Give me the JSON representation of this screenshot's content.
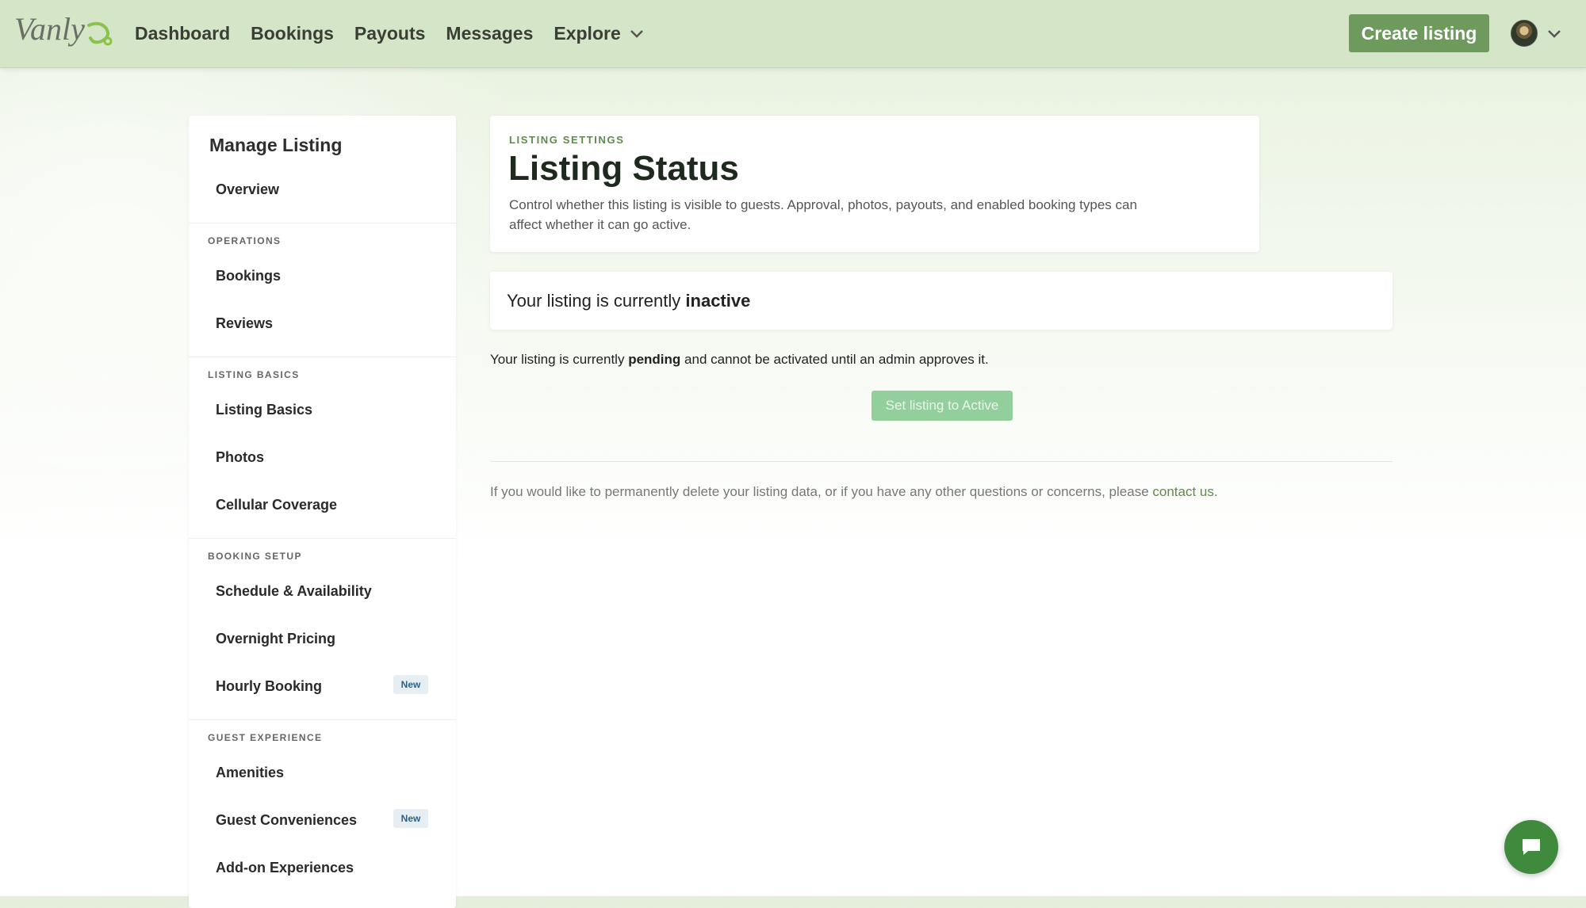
{
  "brand": {
    "logo_text": "Vanly"
  },
  "nav": {
    "items": [
      {
        "label": "Dashboard"
      },
      {
        "label": "Bookings"
      },
      {
        "label": "Payouts"
      },
      {
        "label": "Messages"
      },
      {
        "label": "Explore"
      }
    ],
    "create_label": "Create listing"
  },
  "sidebar": {
    "title": "Manage Listing",
    "overview": "Overview",
    "sections": [
      {
        "label": "OPERATIONS",
        "items": [
          {
            "label": "Bookings"
          },
          {
            "label": "Reviews"
          }
        ]
      },
      {
        "label": "LISTING BASICS",
        "items": [
          {
            "label": "Listing Basics"
          },
          {
            "label": "Photos"
          },
          {
            "label": "Cellular Coverage"
          }
        ]
      },
      {
        "label": "BOOKING SETUP",
        "items": [
          {
            "label": "Schedule & Availability"
          },
          {
            "label": "Overnight Pricing"
          },
          {
            "label": "Hourly Booking",
            "badge": "New"
          }
        ]
      },
      {
        "label": "GUEST EXPERIENCE",
        "items": [
          {
            "label": "Amenities"
          },
          {
            "label": "Guest Conveniences",
            "badge": "New"
          },
          {
            "label": "Add-on Experiences"
          }
        ]
      }
    ]
  },
  "header": {
    "eyebrow": "LISTING SETTINGS",
    "title": "Listing Status",
    "description": "Control whether this listing is visible to guests. Approval, photos, payouts, and enabled booking types can affect whether it can go active."
  },
  "status": {
    "prefix": "Your listing is currently",
    "value": "inactive"
  },
  "pending": {
    "prefix": "Your listing is currently",
    "value": "pending",
    "suffix": "and cannot be activated until an admin approves it."
  },
  "activate_label": "Set listing to Active",
  "footer": {
    "text": "If you would like to permanently delete your listing data, or if you have any other questions or concerns, please",
    "link": "contact us",
    "end": "."
  },
  "colors": {
    "accent": "#6f9a5e",
    "topbar": "#d5e5c8",
    "disabled_button": "#92cf9c",
    "chat": "#3f8a3c"
  },
  "icons": [
    "logo-icon",
    "chevron-down-icon",
    "avatar",
    "chat-icon"
  ]
}
